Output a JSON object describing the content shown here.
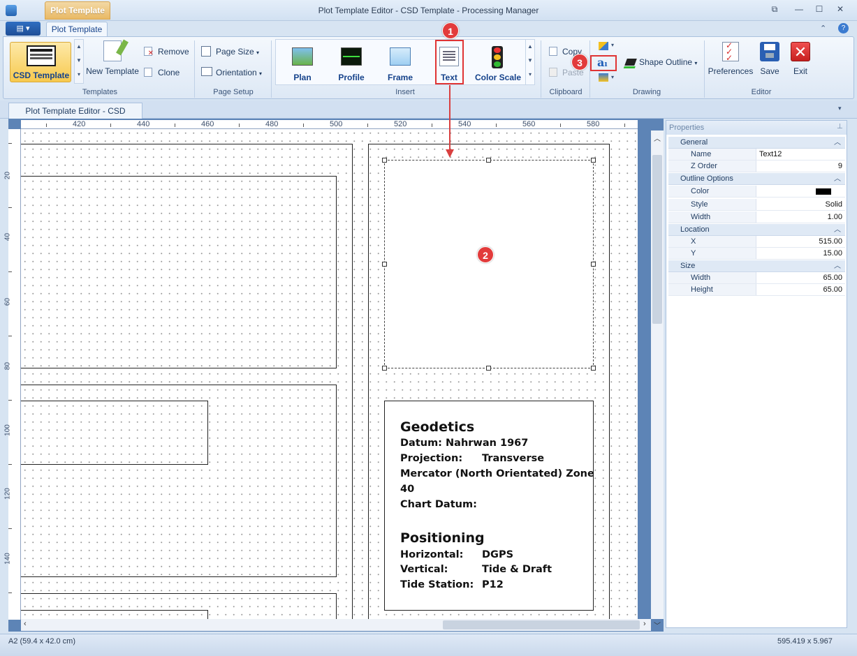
{
  "window": {
    "title": "Plot Template Editor - CSD Template - Processing Manager",
    "contextual_tab": "Plot Template"
  },
  "ribbon": {
    "active_tab": "Plot Template",
    "groups": {
      "templates": {
        "label": "Templates",
        "csd_template": "CSD Template",
        "new_template": "New Template",
        "remove": "Remove",
        "clone": "Clone"
      },
      "page_setup": {
        "label": "Page Setup",
        "page_size": "Page Size",
        "orientation": "Orientation"
      },
      "insert": {
        "label": "Insert",
        "plan": "Plan",
        "profile": "Profile",
        "frame": "Frame",
        "text": "Text",
        "color_scale": "Color Scale"
      },
      "clipboard": {
        "label": "Clipboard",
        "copy": "Copy",
        "paste": "Paste"
      },
      "drawing": {
        "label": "Drawing",
        "shape_outline": "Shape Outline"
      },
      "editor": {
        "label": "Editor",
        "preferences": "Preferences",
        "save": "Save",
        "exit": "Exit"
      }
    }
  },
  "document_tab": "Plot Template Editor - CSD Template",
  "ruler": {
    "top": [
      "420",
      "440",
      "460",
      "480",
      "500",
      "520",
      "540",
      "560",
      "580"
    ],
    "left": [
      "20",
      "40",
      "60",
      "80",
      "100",
      "120",
      "140"
    ]
  },
  "markers": [
    "1",
    "2",
    "3"
  ],
  "info_block": {
    "heading1": "Geodetics",
    "datum": "Datum: Nahrwan 1967",
    "projection_label": "Projection:",
    "projection_value": "Transverse",
    "projection_cont": "Mercator (North Orientated) Zone",
    "zone": "40",
    "chart_datum": "Chart Datum:",
    "heading2": "Positioning",
    "horizontal_label": "Horizontal:",
    "horizontal_value": "DGPS",
    "vertical_label": "Vertical:",
    "vertical_value": "Tide & Draft",
    "tide_label": "Tide Station:",
    "tide_value": "P12"
  },
  "properties": {
    "title": "Properties",
    "categories": {
      "general": "General",
      "outline": "Outline Options",
      "location": "Location",
      "size": "Size"
    },
    "rows": {
      "name": {
        "label": "Name",
        "value": "Text12"
      },
      "z_order": {
        "label": "Z Order",
        "value": "9"
      },
      "color": {
        "label": "Color",
        "value": "#000000"
      },
      "style": {
        "label": "Style",
        "value": "Solid"
      },
      "width": {
        "label": "Width",
        "value": "1.00"
      },
      "x": {
        "label": "X",
        "value": "515.00"
      },
      "y": {
        "label": "Y",
        "value": "15.00"
      },
      "size_width": {
        "label": "Width",
        "value": "65.00"
      },
      "size_height": {
        "label": "Height",
        "value": "65.00"
      }
    }
  },
  "status": {
    "paper": "A2 (59.4 x 42.0 cm)",
    "coords": "595.419 x 5.967"
  }
}
